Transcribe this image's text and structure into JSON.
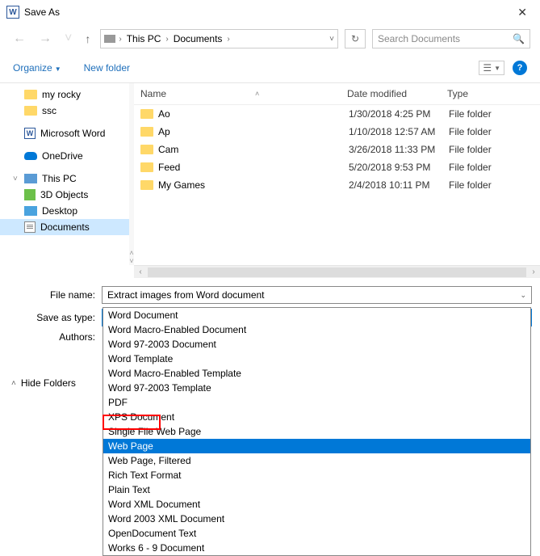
{
  "title": "Save As",
  "breadcrumb": {
    "root": "This PC",
    "folder": "Documents"
  },
  "search_placeholder": "Search Documents",
  "organize": "Organize",
  "new_folder": "New folder",
  "help": "?",
  "tree": [
    {
      "label": "my rocky",
      "icon": "folder"
    },
    {
      "label": "ssc",
      "icon": "folder"
    },
    {
      "label": "Microsoft Word",
      "icon": "word"
    },
    {
      "label": "OneDrive",
      "icon": "onedrive"
    },
    {
      "label": "This PC",
      "icon": "pc",
      "expandable": true
    },
    {
      "label": "3D Objects",
      "icon": "obj"
    },
    {
      "label": "Desktop",
      "icon": "desk"
    },
    {
      "label": "Documents",
      "icon": "doc",
      "selected": true
    }
  ],
  "columns": {
    "name": "Name",
    "date": "Date modified",
    "type": "Type"
  },
  "files": [
    {
      "name": "Ao",
      "date": "1/30/2018 4:25 PM",
      "type": "File folder"
    },
    {
      "name": "Ap",
      "date": "1/10/2018 12:57 AM",
      "type": "File folder"
    },
    {
      "name": "Cam",
      "date": "3/26/2018 11:33 PM",
      "type": "File folder"
    },
    {
      "name": "Feed",
      "date": "5/20/2018 9:53 PM",
      "type": "File folder"
    },
    {
      "name": "My Games",
      "date": "2/4/2018 10:11 PM",
      "type": "File folder"
    }
  ],
  "form": {
    "file_name_label": "File name:",
    "file_name_value": "Extract images from Word document",
    "save_type_label": "Save as type:",
    "save_type_value": "Word Document",
    "authors_label": "Authors:"
  },
  "type_options": [
    "Word Document",
    "Word Macro-Enabled Document",
    "Word 97-2003 Document",
    "Word Template",
    "Word Macro-Enabled Template",
    "Word 97-2003 Template",
    "PDF",
    "XPS Document",
    "Single File Web Page",
    "Web Page",
    "Web Page, Filtered",
    "Rich Text Format",
    "Plain Text",
    "Word XML Document",
    "Word 2003 XML Document",
    "OpenDocument Text",
    "Works 6 - 9 Document"
  ],
  "selected_option_index": 9,
  "hide_folders": "Hide Folders"
}
